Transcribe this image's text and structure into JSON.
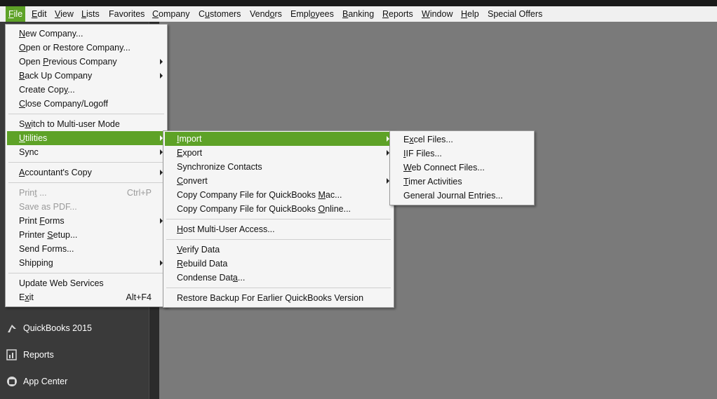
{
  "menubar": [
    {
      "pre": "",
      "key": "F",
      "post": "ile",
      "active": true
    },
    {
      "pre": "",
      "key": "E",
      "post": "dit"
    },
    {
      "pre": "",
      "key": "V",
      "post": "iew"
    },
    {
      "pre": "",
      "key": "L",
      "post": "ists"
    },
    {
      "pre": "Favorites",
      "key": "",
      "post": ""
    },
    {
      "pre": "",
      "key": "C",
      "post": "ompany"
    },
    {
      "pre": "C",
      "key": "u",
      "post": "stomers"
    },
    {
      "pre": "Vend",
      "key": "o",
      "post": "rs"
    },
    {
      "pre": "Empl",
      "key": "o",
      "post": "yees"
    },
    {
      "pre": "",
      "key": "B",
      "post": "anking"
    },
    {
      "pre": "",
      "key": "R",
      "post": "eports"
    },
    {
      "pre": "",
      "key": "W",
      "post": "indow"
    },
    {
      "pre": "",
      "key": "H",
      "post": "elp"
    },
    {
      "pre": "Special Offers",
      "key": "",
      "post": ""
    }
  ],
  "file_menu": [
    {
      "pre": "",
      "key": "N",
      "post": "ew Company..."
    },
    {
      "pre": "",
      "key": "O",
      "post": "pen or Restore Company..."
    },
    {
      "pre": "Open ",
      "key": "P",
      "post": "revious Company",
      "sub": true
    },
    {
      "pre": "",
      "key": "B",
      "post": "ack Up Company",
      "sub": true
    },
    {
      "pre": "Create Cop",
      "key": "y",
      "post": "..."
    },
    {
      "pre": "",
      "key": "C",
      "post": "lose Company/Logoff"
    },
    {
      "sep": true
    },
    {
      "pre": "S",
      "key": "w",
      "post": "itch to Multi-user Mode"
    },
    {
      "pre": "",
      "key": "U",
      "post": "tilities",
      "sub": true,
      "hl": true
    },
    {
      "pre": "Sync",
      "key": "",
      "post": "",
      "sub": true
    },
    {
      "sep": true
    },
    {
      "pre": "",
      "key": "A",
      "post": "ccountant's Copy",
      "sub": true
    },
    {
      "sep": true
    },
    {
      "pre": "Prin",
      "key": "t",
      "post": " ...",
      "shortcut": "Ctrl+P",
      "disabled": true
    },
    {
      "pre": "Save as PDF...",
      "key": "",
      "post": "",
      "disabled": true
    },
    {
      "pre": "Print ",
      "key": "F",
      "post": "orms",
      "sub": true
    },
    {
      "pre": "Printer ",
      "key": "S",
      "post": "etup..."
    },
    {
      "pre": "Send Forms...",
      "key": "",
      "post": ""
    },
    {
      "pre": "Shippin",
      "key": "g",
      "post": "",
      "sub": true
    },
    {
      "sep": true
    },
    {
      "pre": "Update Web Services",
      "key": "",
      "post": ""
    },
    {
      "pre": "E",
      "key": "x",
      "post": "it",
      "shortcut": "Alt+F4"
    }
  ],
  "utilities_menu": [
    {
      "pre": "",
      "key": "I",
      "post": "mport",
      "sub": true,
      "hl": true
    },
    {
      "pre": "",
      "key": "E",
      "post": "xport",
      "sub": true
    },
    {
      "pre": "Synchronize Contacts",
      "key": "",
      "post": ""
    },
    {
      "pre": "",
      "key": "C",
      "post": "onvert",
      "sub": true
    },
    {
      "pre": "Copy Company File for QuickBooks ",
      "key": "M",
      "post": "ac..."
    },
    {
      "pre": "Copy Company File for QuickBooks ",
      "key": "O",
      "post": "nline..."
    },
    {
      "sep": true
    },
    {
      "pre": "",
      "key": "H",
      "post": "ost Multi-User Access..."
    },
    {
      "sep": true
    },
    {
      "pre": "",
      "key": "V",
      "post": "erify Data"
    },
    {
      "pre": "",
      "key": "R",
      "post": "ebuild Data"
    },
    {
      "pre": "Condense Dat",
      "key": "a",
      "post": "..."
    },
    {
      "sep": true
    },
    {
      "pre": "Restore Backup For Earlier QuickBooks Version",
      "key": "",
      "post": ""
    }
  ],
  "import_menu": [
    {
      "pre": "E",
      "key": "x",
      "post": "cel Files..."
    },
    {
      "pre": "",
      "key": "I",
      "post": "IF Files..."
    },
    {
      "pre": "",
      "key": "W",
      "post": "eb Connect Files..."
    },
    {
      "pre": "",
      "key": "T",
      "post": "imer Activities"
    },
    {
      "pre": "General Journal Entries...",
      "key": "",
      "post": ""
    }
  ],
  "left_nav": [
    {
      "label": "QuickBooks 2015",
      "icon": "arrow-up-icon"
    },
    {
      "label": "Reports",
      "icon": "reports-icon"
    },
    {
      "label": "App Center",
      "icon": "app-center-icon"
    }
  ],
  "colors": {
    "accent": "#5ea227",
    "workspace": "#7a7a7a",
    "sidebar": "#3a3a3a"
  }
}
